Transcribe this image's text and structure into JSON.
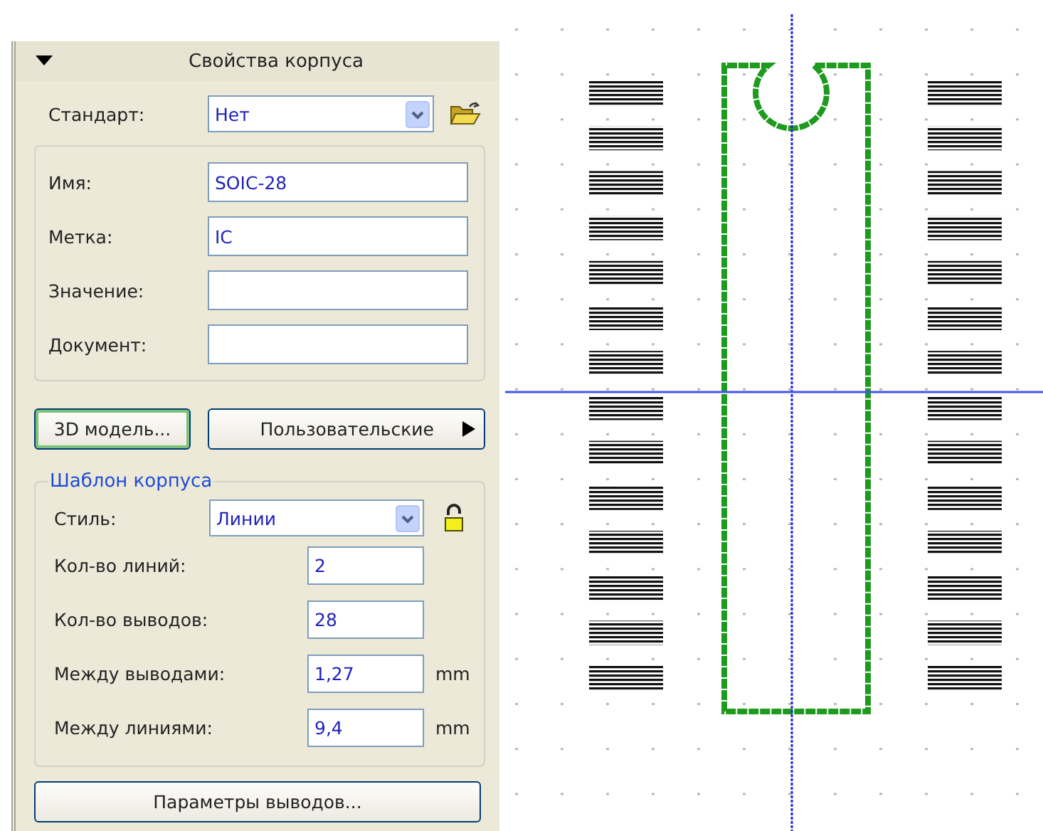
{
  "panel": {
    "title": "Свойства корпуса",
    "expanded": true
  },
  "standard": {
    "label": "Стандарт:",
    "value": "Нет"
  },
  "fields": [
    {
      "label": "Имя:",
      "value": "SOIC-28"
    },
    {
      "label": "Метка:",
      "value": "IC"
    },
    {
      "label": "Значение:"
    },
    {
      "label": "Документ:"
    }
  ],
  "buttons": [
    {
      "label": "3D модель...",
      "focused": true,
      "submenu": false
    },
    {
      "label": "Пользовательские",
      "focused": false,
      "submenu": true
    }
  ],
  "template": {
    "title": "Шаблон корпуса",
    "style": {
      "label": "Стиль:",
      "value": "Линии",
      "locked": false
    },
    "params": [
      {
        "label": "Кол-во линий:",
        "value": "2"
      },
      {
        "label": "Кол-во выводов:",
        "value": "28"
      },
      {
        "label": "Между выводами:",
        "value": "1,27",
        "unit": "mm"
      },
      {
        "label": "Между линиями:",
        "value": "9,4",
        "unit": "mm"
      }
    ]
  },
  "pin_params_button": "Параметры выводов..."
}
